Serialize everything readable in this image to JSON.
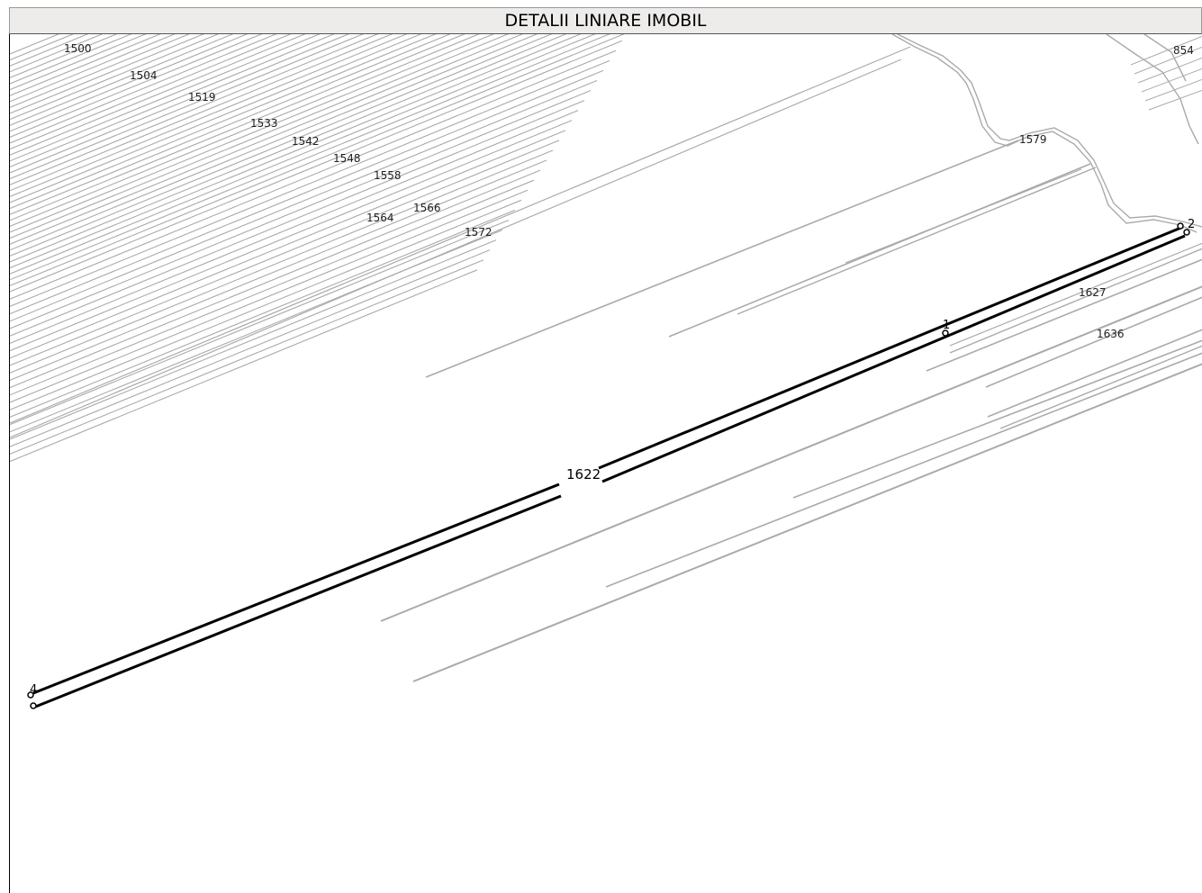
{
  "title": "DETALII LINIARE IMOBIL",
  "parcel_labels": [
    {
      "id": "p1500",
      "text": "1500"
    },
    {
      "id": "p1504",
      "text": "1504"
    },
    {
      "id": "p1519",
      "text": "1519"
    },
    {
      "id": "p1533",
      "text": "1533"
    },
    {
      "id": "p1542",
      "text": "1542"
    },
    {
      "id": "p1548",
      "text": "1548"
    },
    {
      "id": "p1558",
      "text": "1558"
    },
    {
      "id": "p1564",
      "text": "1564"
    },
    {
      "id": "p1566",
      "text": "1566"
    },
    {
      "id": "p1572",
      "text": "1572"
    },
    {
      "id": "p1579",
      "text": "1579"
    },
    {
      "id": "p854",
      "text": "854"
    },
    {
      "id": "p1627",
      "text": "1627"
    },
    {
      "id": "p1636",
      "text": "1636"
    }
  ],
  "subject_parcel": {
    "label": "1622"
  },
  "vertices": [
    {
      "id": "v1",
      "label": "1"
    },
    {
      "id": "v2",
      "label": "2"
    },
    {
      "id": "v4",
      "label": "4"
    }
  ],
  "colors": {
    "neighbor_line": "#aaaaaa",
    "subject_line": "#000000",
    "title_bg": "#eeebeb"
  }
}
